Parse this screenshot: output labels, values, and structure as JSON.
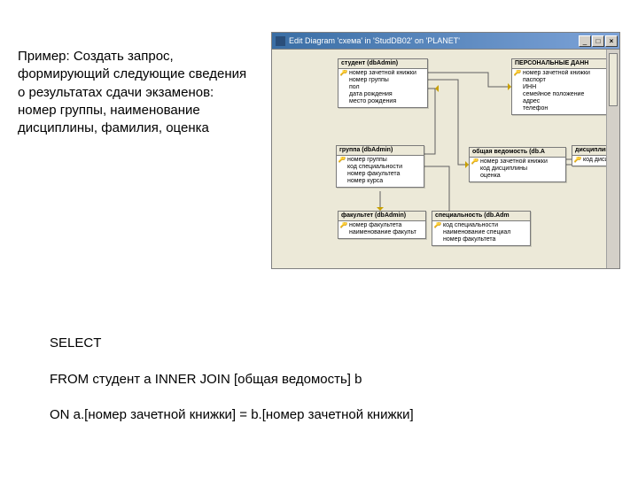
{
  "description": "Пример: Создать запрос, формирующий следующие сведения о результатах сдачи экзаменов: номер группы, наименование дисциплины, фамилия, оценка",
  "sql": {
    "line1": "SELECT",
    "line2": "FROM   студент  a  INNER JOIN [общая ведомость]  b",
    "line3": "ON a.[номер зачетной книжки] = b.[номер зачетной книжки]"
  },
  "window": {
    "title": "Edit Diagram 'схема' in 'StudDB02' on 'PLANET'"
  },
  "tables": {
    "student": {
      "title": "студент (dbAdmin)",
      "cols": [
        "номер зачетной книжки",
        "номер группы",
        "пол",
        "дата рождения",
        "место рождения"
      ]
    },
    "personal": {
      "title": "ПЕРСОНАЛЬНЫЕ ДАНН",
      "cols": [
        "номер зачетной книжки",
        "паспорт",
        "ИНН",
        "семейное положение",
        "адрес",
        "телефон"
      ]
    },
    "group": {
      "title": "группа (dbAdmin)",
      "cols": [
        "номер группы",
        "код специальности",
        "номер факультета",
        "номер курса"
      ]
    },
    "vedom": {
      "title": "общая ведомость (db.A",
      "cols": [
        "номер зачетной книжки",
        "код дисциплины",
        "оценка"
      ]
    },
    "disc": {
      "title": "дисциплина (dbAdmin)",
      "cols": [
        "код дисциплины"
      ]
    },
    "fac": {
      "title": "факультет (dbAdmin)",
      "cols": [
        "номер факультета",
        "наименование факульт"
      ]
    },
    "spec": {
      "title": "специальность (db.Adm",
      "cols": [
        "код специальности",
        "наименование специал",
        "номер факультета"
      ]
    }
  }
}
